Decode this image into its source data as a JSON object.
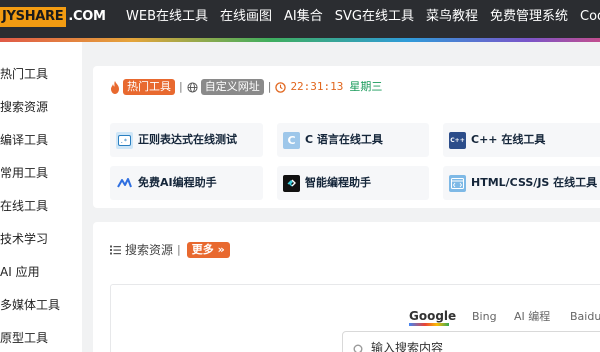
{
  "logo": {
    "box_text": "JYSHARE",
    "rest_text": ".COM"
  },
  "nav": [
    "WEB在线工具",
    "在线画图",
    "AI集合",
    "SVG在线工具",
    "菜鸟教程",
    "免费管理系统",
    "Cod"
  ],
  "sidebar": [
    "热门工具",
    "搜索资源",
    "编译工具",
    "常用工具",
    "在线工具",
    "技术学习",
    "AI 应用",
    "多媒体工具",
    "原型工具"
  ],
  "hot_bar": {
    "hot_tag": "热门工具",
    "custom_tag": "自定义网址",
    "time": "22:31:13",
    "weekday": "星期三"
  },
  "tools": [
    {
      "label": "正则表达式在线测试",
      "icon": "regex-icon"
    },
    {
      "label": "C 语言在线工具",
      "icon": "c-lang-icon"
    },
    {
      "label": "C++ 在线工具",
      "icon": "cpp-icon"
    },
    {
      "label": "免费AI编程助手",
      "icon": "ai-assistant-icon"
    },
    {
      "label": "智能编程助手",
      "icon": "smart-coding-icon"
    },
    {
      "label": "HTML/CSS/JS 在线工具",
      "icon": "html-icon"
    }
  ],
  "search_section": {
    "title": "搜索资源",
    "separator": "|",
    "more": "更多",
    "engines": [
      "Google",
      "Bing",
      "AI 编程",
      "Baidu"
    ],
    "active_engine": "Google",
    "placeholder": "输入搜索内容"
  },
  "colors": {
    "topbar": "#2b2d31",
    "logo_orange": "#f39c12",
    "hot_tag": "#e8692f",
    "custom_tag": "#8a8a8a",
    "time": "#e1661e",
    "weekday": "#1a9b5b"
  }
}
